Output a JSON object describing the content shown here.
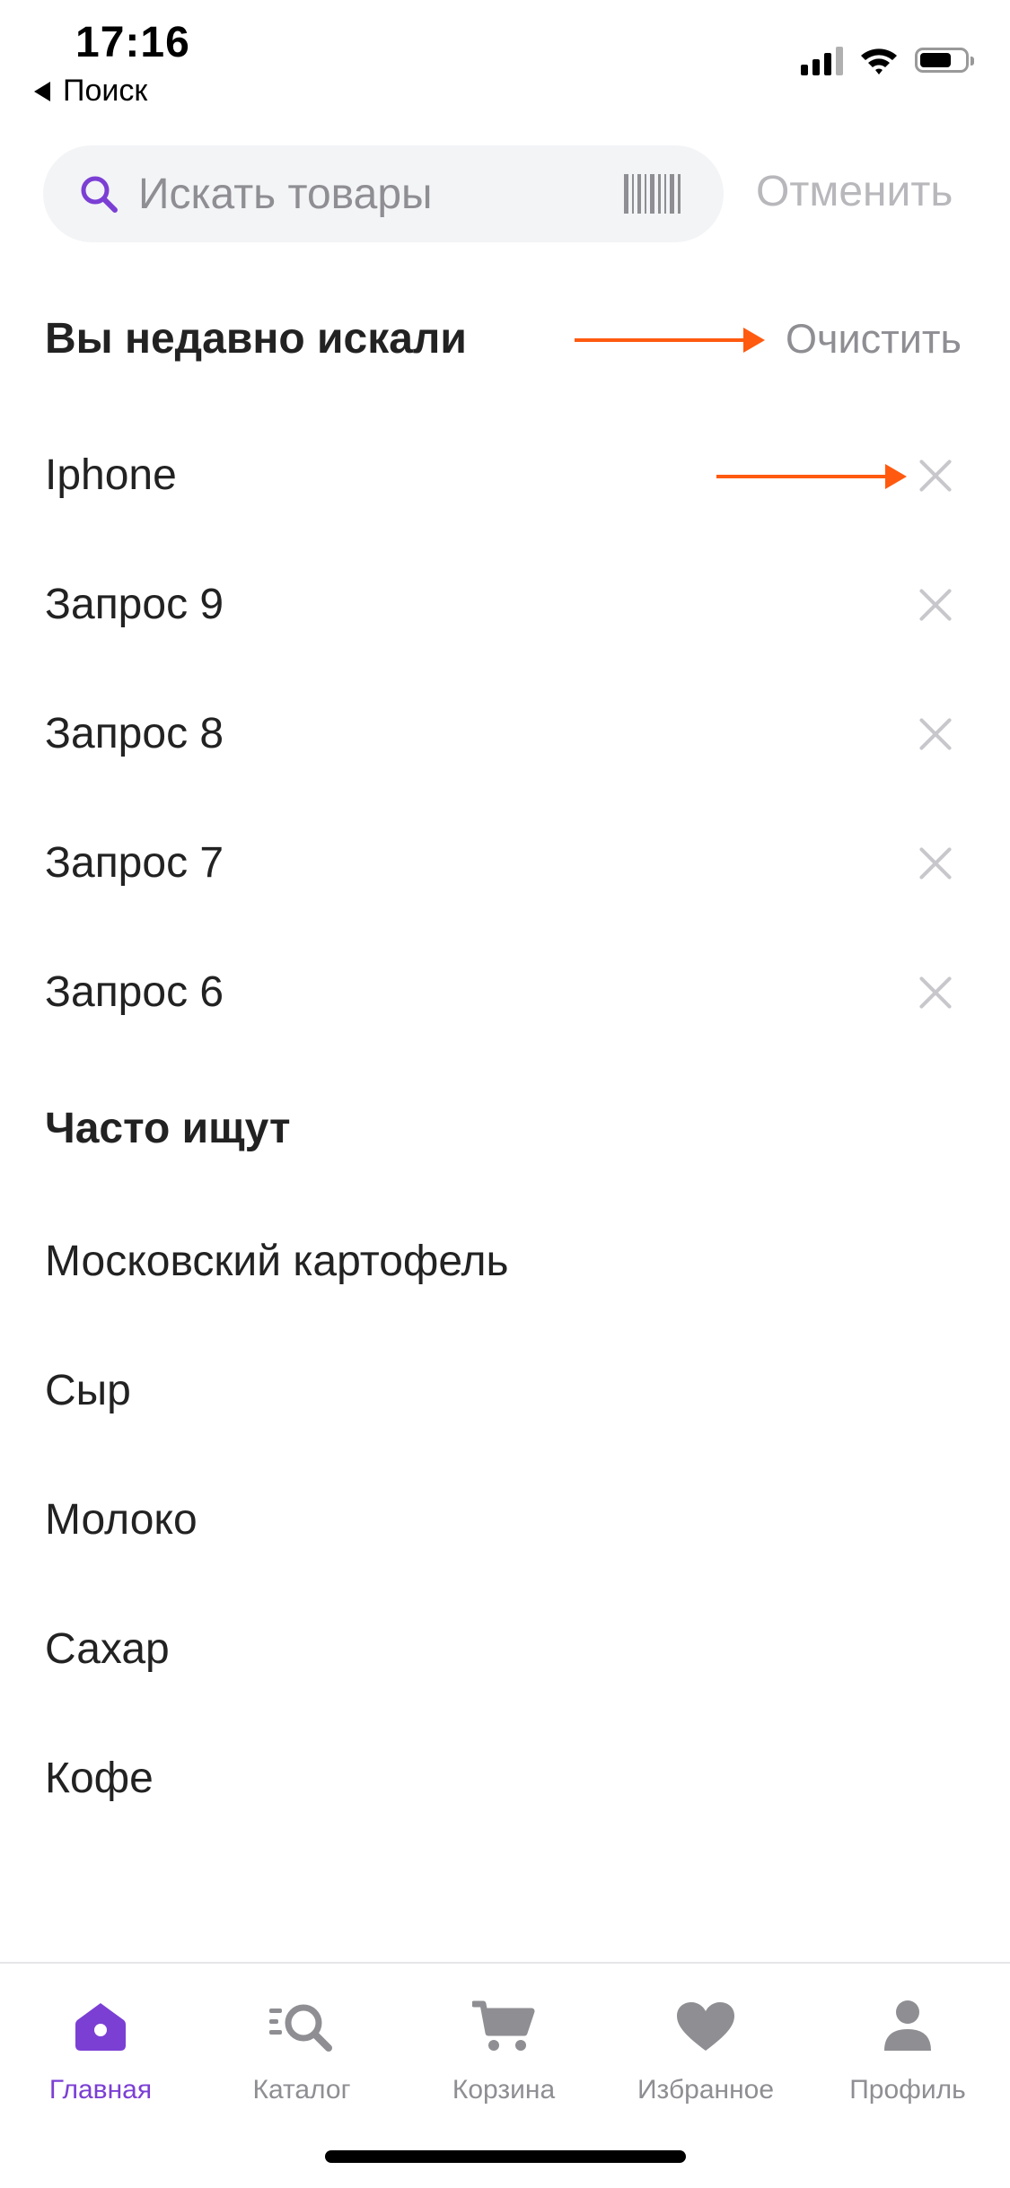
{
  "status_bar": {
    "time": "17:16",
    "back_label": "Поиск",
    "battery_level": 0.7
  },
  "search": {
    "placeholder": "Искать товары",
    "value": "",
    "cancel_label": "Отменить"
  },
  "recent": {
    "title": "Вы недавно искали",
    "clear_label": "Очистить",
    "items": [
      "Iphone",
      "Запрос 9",
      "Запрос 8",
      "Запрос 7",
      "Запрос 6"
    ]
  },
  "popular": {
    "title": "Часто ищут",
    "items": [
      "Московский картофель",
      "Сыр",
      "Молоко",
      "Сахар",
      "Кофе"
    ]
  },
  "tabs": [
    {
      "label": "Главная",
      "icon": "home-icon",
      "active": true
    },
    {
      "label": "Каталог",
      "icon": "catalog-search-icon",
      "active": false
    },
    {
      "label": "Корзина",
      "icon": "cart-icon",
      "active": false
    },
    {
      "label": "Избранное",
      "icon": "heart-icon",
      "active": false
    },
    {
      "label": "Профиль",
      "icon": "profile-icon",
      "active": false
    }
  ],
  "colors": {
    "accent": "#7b3fd4",
    "annotation_arrow": "#ff5a0f",
    "inactive": "#8e8e93"
  }
}
